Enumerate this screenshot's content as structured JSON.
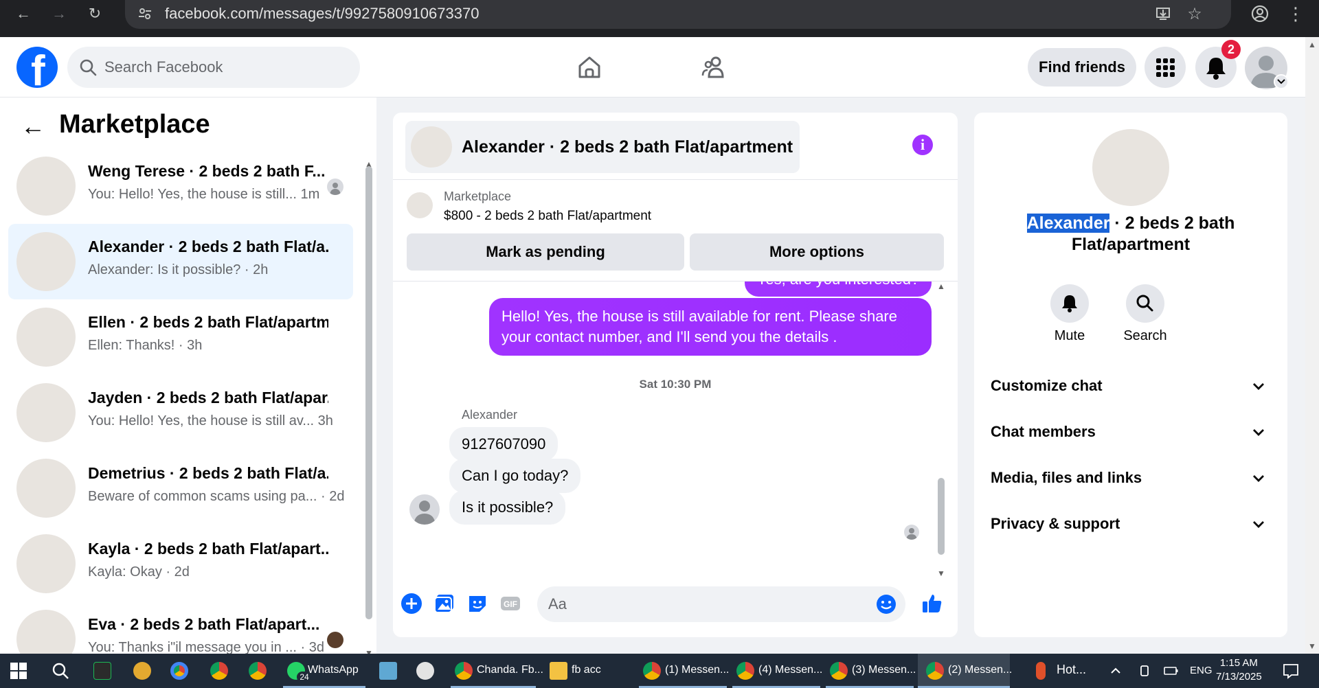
{
  "browser": {
    "url": "facebook.com/messages/t/9927580910673370"
  },
  "header": {
    "search_placeholder": "Search Facebook",
    "find_friends_label": "Find friends",
    "notification_count": "2"
  },
  "sidebar": {
    "title": "Marketplace",
    "chats": [
      {
        "name": "Weng Terese · 2 beds 2 bath F...",
        "preview": "You: Hello! Yes, the house is still...  1m",
        "active": false,
        "seen": "avatar"
      },
      {
        "name": "Alexander · 2 beds 2 bath Flat/a...",
        "preview": "Alexander: Is it possible? · 2h",
        "active": true,
        "seen": ""
      },
      {
        "name": "Ellen · 2 beds 2 bath Flat/apartm...",
        "preview": "Ellen: Thanks! · 3h",
        "active": false,
        "seen": ""
      },
      {
        "name": "Jayden · 2 beds 2 bath Flat/apar...",
        "preview": "You: Hello! Yes, the house is still av...  3h",
        "active": false,
        "seen": ""
      },
      {
        "name": "Demetrius · 2 beds 2 bath Flat/a...",
        "preview": "Beware of common scams using pa... · 2d",
        "active": false,
        "seen": ""
      },
      {
        "name": "Kayla · 2 beds 2 bath Flat/apart...",
        "preview": "Kayla: Okay · 2d",
        "active": false,
        "seen": ""
      },
      {
        "name": "Eva · 2 beds 2 bath Flat/apart...",
        "preview": "You: Thanks i\"il message you in ...  · 3d",
        "active": false,
        "seen": "photo"
      }
    ]
  },
  "chat": {
    "title": "Alexander · 2 beds 2 bath Flat/apartment",
    "listing_source": "Marketplace",
    "listing_price_title": "$800 - 2 beds 2 bath Flat/apartment",
    "mark_pending_label": "Mark as pending",
    "more_options_label": "More options",
    "partial_message": "Yes, are you interested?",
    "outgoing_message": "Hello! Yes, the house is still available for rent. Please share your contact number, and I'll send you the details .",
    "timestamp": "Sat 10:30 PM",
    "sender_name": "Alexander",
    "incoming": [
      "9127607090",
      "Can I go today?",
      "Is it possible?"
    ],
    "composer_placeholder": "Aa"
  },
  "info": {
    "name_highlight": "Alexander",
    "name_rest": " · 2 beds 2 bath",
    "name_line2": "Flat/apartment",
    "mute_label": "Mute",
    "search_label": "Search",
    "sections": [
      "Customize chat",
      "Chat members",
      "Media, files and links",
      "Privacy & support"
    ]
  },
  "taskbar": {
    "items": [
      "WhatsApp",
      "Chanda. Fb...",
      "fb acc",
      "(1) Messen...",
      "(4) Messen...",
      "(3) Messen...",
      "(2) Messen...",
      "Hot..."
    ],
    "whatsapp_badge": "24",
    "language": "ENG",
    "time": "1:15 AM",
    "date": "7/13/2025"
  },
  "colors": {
    "fb_blue": "#0866ff",
    "messenger_purple": "#a033ff",
    "active_chat_bg": "#ebf5ff",
    "notification_red": "#e41e3f"
  }
}
